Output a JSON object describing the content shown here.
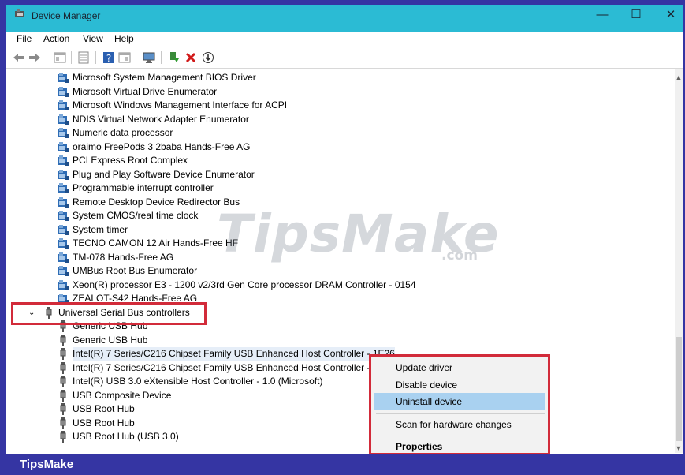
{
  "window": {
    "title": "Device Manager",
    "controls": {
      "minimize": "—",
      "maximize": "☐",
      "close": "✕"
    }
  },
  "menubar": [
    "File",
    "Action",
    "View",
    "Help"
  ],
  "toolbar": {
    "icons": [
      "back-arrow-icon",
      "forward-arrow-icon",
      "show-hide-tree-icon",
      "properties-icon",
      "help-icon",
      "view-icon",
      "monitor-icon",
      "update-driver-icon",
      "uninstall-icon",
      "download-icon"
    ]
  },
  "tree": {
    "system_devices": [
      "Microsoft System Management BIOS Driver",
      "Microsoft Virtual Drive Enumerator",
      "Microsoft Windows Management Interface for ACPI",
      "NDIS Virtual Network Adapter Enumerator",
      "Numeric data processor",
      "oraimo FreePods 3 2baba Hands-Free AG",
      "PCI Express Root Complex",
      "Plug and Play Software Device Enumerator",
      "Programmable interrupt controller",
      "Remote Desktop Device Redirector Bus",
      "System CMOS/real time clock",
      "System timer",
      "TECNO CAMON 12 Air Hands-Free HF",
      "TM-078 Hands-Free AG",
      "UMBus Root Bus Enumerator",
      "Xeon(R) processor E3 - 1200 v2/3rd Gen Core processor DRAM Controller - 0154",
      "ZEALOT-S42 Hands-Free AG"
    ],
    "usb_category": "Universal Serial Bus controllers",
    "usb_devices": [
      "Generic USB Hub",
      "Generic USB Hub",
      "Intel(R) 7 Series/C216 Chipset Family USB Enhanced Host Controller - 1E26",
      "Intel(R) 7 Series/C216 Chipset Family USB Enhanced Host Controller - 1E2D",
      "Intel(R) USB 3.0 eXtensible Host Controller - 1.0 (Microsoft)",
      "USB Composite Device",
      "USB Root Hub",
      "USB Root Hub",
      "USB Root Hub (USB 3.0)"
    ],
    "selected_index": 2
  },
  "context_menu": {
    "items": [
      "Update driver",
      "Disable device",
      "Uninstall device",
      "Scan for hardware changes",
      "Properties"
    ],
    "highlighted": "Uninstall device"
  },
  "watermark": {
    "main": "TipsMake",
    "sub": ".com"
  },
  "footer": {
    "brand": "TipsMake"
  },
  "colors": {
    "titlebar": "#2bbbd4",
    "frame_blue": "#3535a3",
    "highlight_red": "#d22b3a",
    "menu_highlight": "#a9d1f0"
  }
}
